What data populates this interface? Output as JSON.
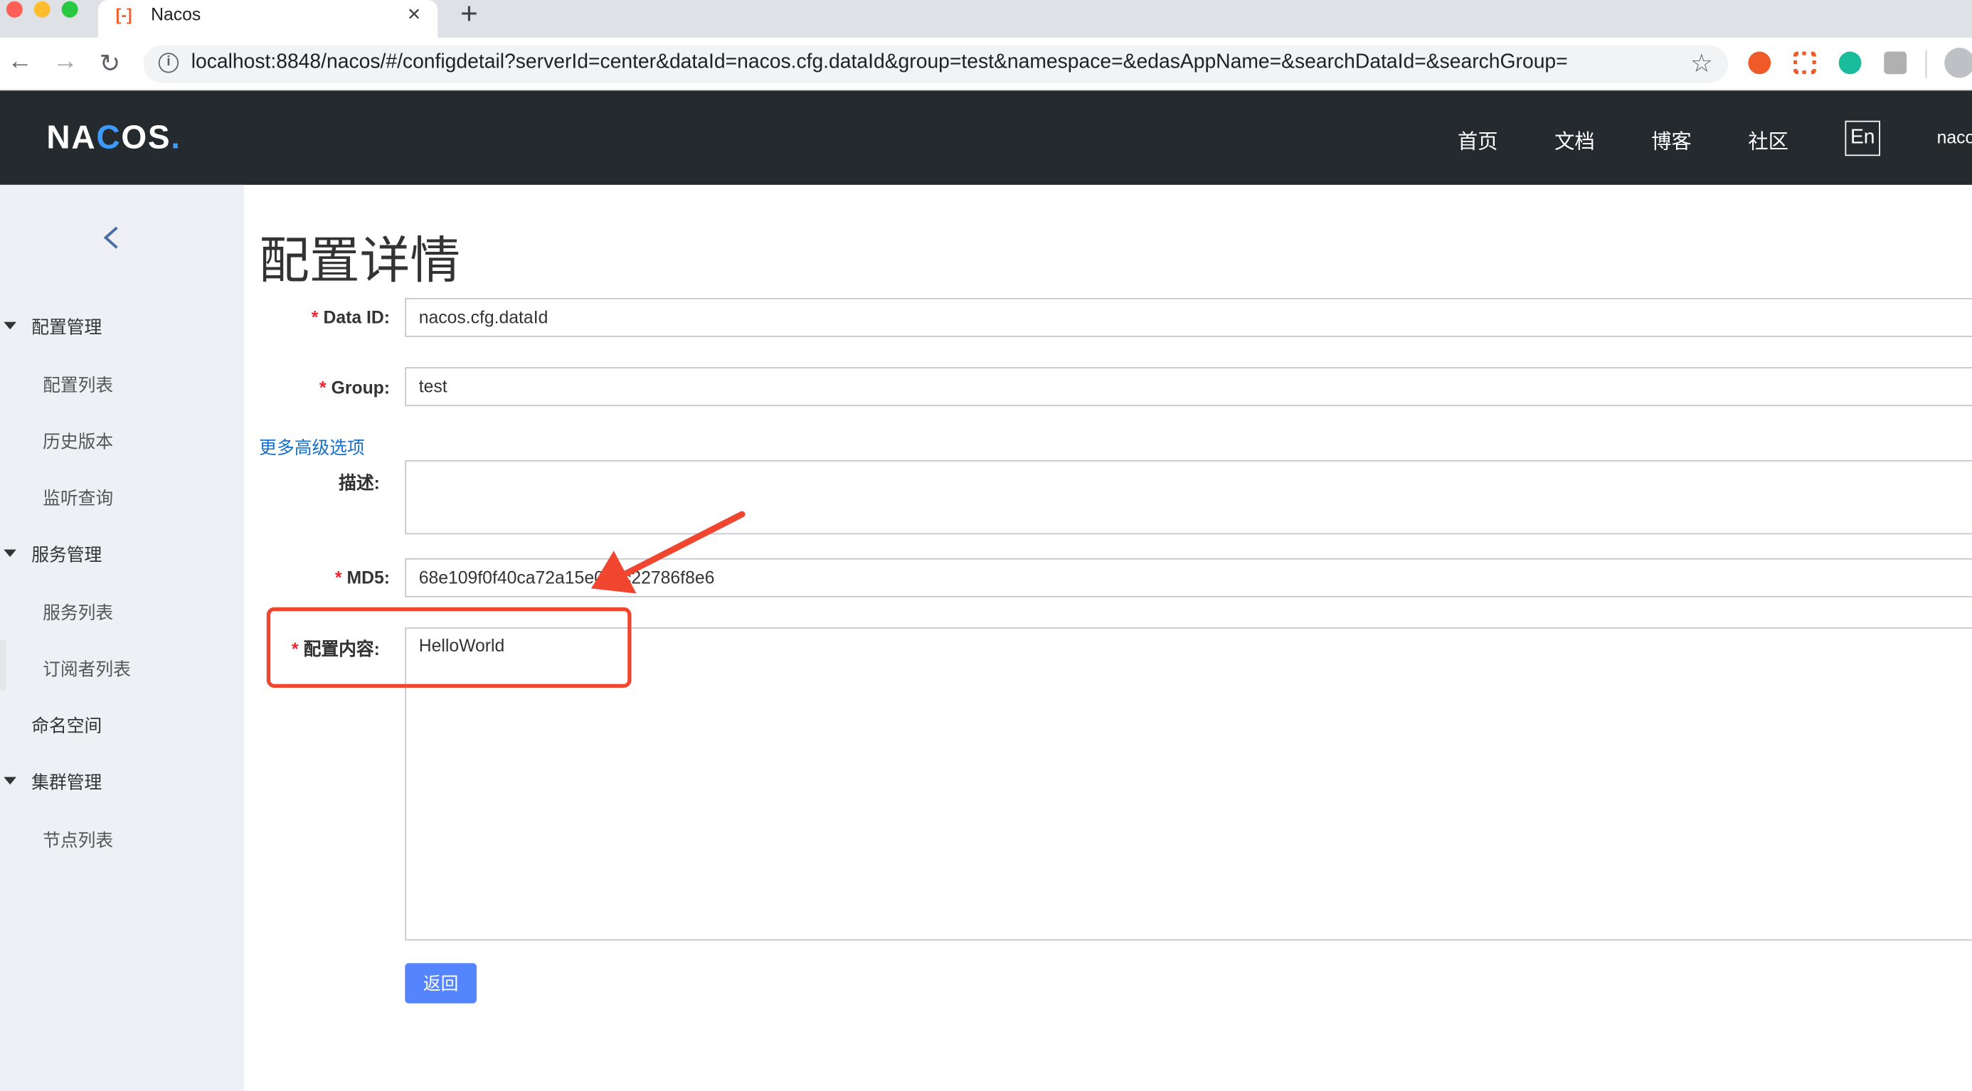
{
  "browser": {
    "tab_title": "Nacos",
    "tab_favicon": "[-]",
    "tab_close": "×",
    "new_tab": "+",
    "url": "localhost:8848/nacos/#/configdetail?serverId=center&dataId=nacos.cfg.dataId&group=test&namespace=&edasAppName=&searchDataId=&searchGroup=",
    "nav": {
      "back": "←",
      "forward": "→",
      "reload": "↻"
    },
    "star": "☆",
    "colors": {
      "close": "#ff5f57",
      "minimize": "#febc2e",
      "maximize": "#28c840"
    }
  },
  "header": {
    "logo_prefix": "NA",
    "logo_c": "C",
    "logo_suffix": "OS",
    "logo_dot": ".",
    "nav": [
      "首页",
      "文档",
      "博客",
      "社区"
    ],
    "lang": "En",
    "user": "naco"
  },
  "sidebar": {
    "groups": [
      {
        "label": "配置管理",
        "items": [
          "配置列表",
          "历史版本",
          "监听查询"
        ]
      },
      {
        "label": "服务管理",
        "items": [
          "服务列表",
          "订阅者列表"
        ]
      },
      {
        "label": "命名空间",
        "items": []
      },
      {
        "label": "集群管理",
        "items": [
          "节点列表"
        ]
      }
    ]
  },
  "main": {
    "title": "配置详情",
    "required_mark": "*",
    "fields": {
      "data_id": {
        "label": "Data ID:",
        "value": "nacos.cfg.dataId"
      },
      "group": {
        "label": "Group:",
        "value": "test"
      },
      "description": {
        "label": "描述:",
        "value": ""
      },
      "md5": {
        "label": "MD5:",
        "value": "68e109f0f40ca72a15e05cc22786f8e6"
      },
      "content": {
        "label": "配置内容:",
        "value": "HelloWorld"
      }
    },
    "advanced_link": "更多高级选项",
    "back_button": "返回"
  },
  "annotation_color": "#f0462f"
}
